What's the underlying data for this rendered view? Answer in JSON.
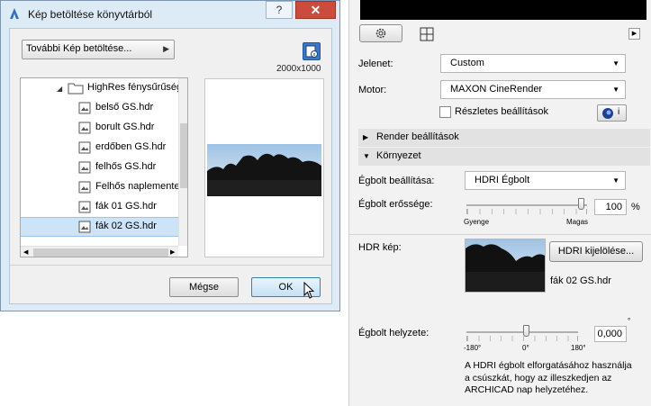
{
  "dialog": {
    "title": "Kép betöltése könyvtárból",
    "help_label": "?",
    "close_label": "✕",
    "more_images_label": "További Kép betöltése...",
    "dimensions": "2000x1000",
    "folder_name": "HighRes fénysűrűség",
    "files": [
      "belső GS.hdr",
      "borult GS.hdr",
      "erdőben GS.hdr",
      "felhős GS.hdr",
      "Felhős naplemente G",
      "fák 01 GS.hdr",
      "fák 02 GS.hdr"
    ],
    "selected_file": "fák 02 GS.hdr",
    "cancel_label": "Mégse",
    "ok_label": "OK"
  },
  "panel": {
    "scene_label": "Jelenet:",
    "scene_value": "Custom",
    "engine_label": "Motor:",
    "engine_value": "MAXON CineRender",
    "detailed_label": "Részletes beállítások",
    "info_label": "i",
    "render_settings_label": "Render beállítások",
    "environment_label": "Környezet",
    "sky_settings_label": "Égbolt beállítása:",
    "sky_settings_value": "HDRI Égbolt",
    "sky_strength_label": "Égbolt erőssége:",
    "sky_strength_value": "100",
    "sky_strength_unit": "%",
    "weak_label": "Gyenge",
    "strong_label": "Magas",
    "hdr_image_label": "HDR kép:",
    "hdr_select_label": "HDRI kijelölése...",
    "hdr_file_name": "fák 02 GS.hdr",
    "sky_position_label": "Égbolt helyzete:",
    "sky_position_value": "0,000",
    "degree_symbol": "°",
    "rot_min": "-180°",
    "rot_mid": "0°",
    "rot_max": "180°",
    "help_text": "A HDRI égbolt elforgatásához használja a csúszkát, hogy az illeszkedjen az ARCHICAD nap helyzetéhez."
  },
  "colors": {
    "dialog_frame": "#dcebf6",
    "close_red": "#c94c3f",
    "selection": "#cde3f8",
    "panel_bg": "#f2f2f2"
  }
}
